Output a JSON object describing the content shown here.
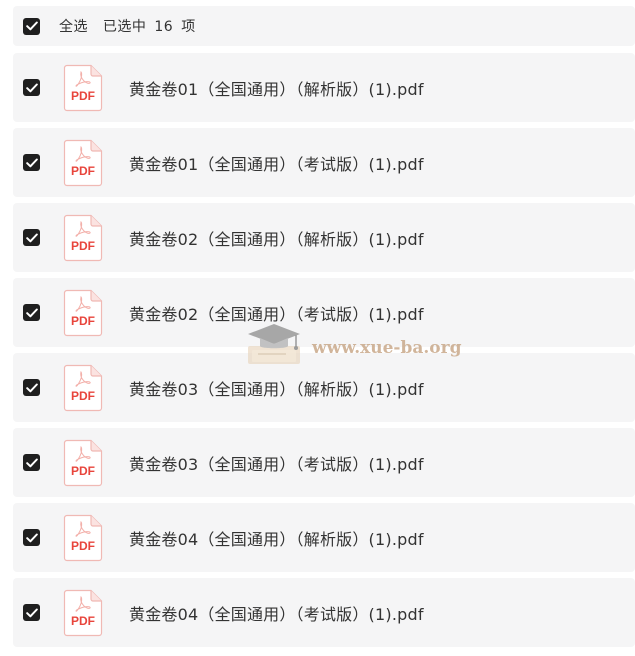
{
  "header": {
    "select_all_label": "全选",
    "selected_prefix": "已选中",
    "selected_count": "16",
    "selected_suffix": "项"
  },
  "icon": {
    "file_icon": "pdf-file-icon",
    "file_icon_text": "PDF",
    "checkbox_icon": "checkmark-icon"
  },
  "files": [
    {
      "name": "黄金卷01（全国通用）（解析版）(1).pdf",
      "checked": true
    },
    {
      "name": "黄金卷01（全国通用）（考试版）(1).pdf",
      "checked": true
    },
    {
      "name": "黄金卷02（全国通用）（解析版）(1).pdf",
      "checked": true
    },
    {
      "name": "黄金卷02（全国通用）（考试版）(1).pdf",
      "checked": true
    },
    {
      "name": "黄金卷03（全国通用）（解析版）(1).pdf",
      "checked": true
    },
    {
      "name": "黄金卷03（全国通用）（考试版）(1).pdf",
      "checked": true
    },
    {
      "name": "黄金卷04（全国通用）（解析版）(1).pdf",
      "checked": true
    },
    {
      "name": "黄金卷04（全国通用）（考试版）(1).pdf",
      "checked": true
    }
  ],
  "watermark": {
    "text": "www.xue-ba.org",
    "icon": "graduation-cap-icon"
  },
  "colors": {
    "row_background": "#f5f5f6",
    "checkbox": "#1f1f1f",
    "pdf_red": "#e8453c",
    "text": "#333333"
  }
}
